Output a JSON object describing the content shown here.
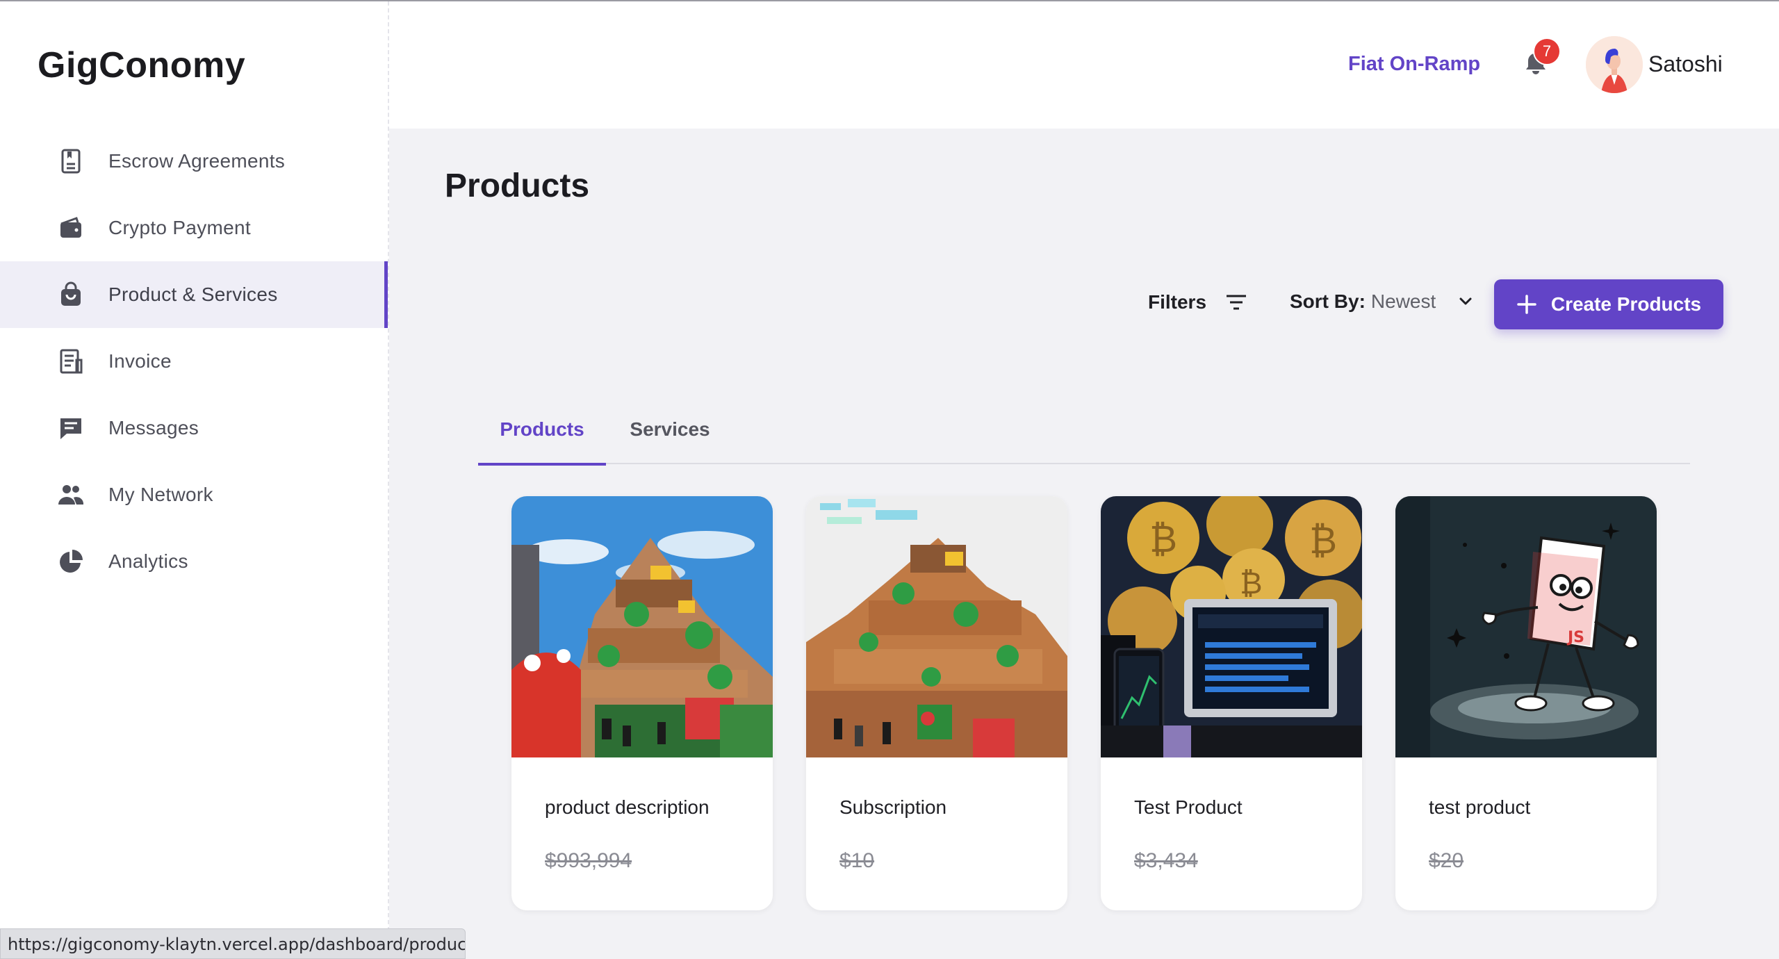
{
  "app": {
    "logo": "GigConomy"
  },
  "sidebar": {
    "items": [
      {
        "label": "Escrow Agreements",
        "icon": "document-icon",
        "active": false
      },
      {
        "label": "Crypto Payment",
        "icon": "wallet-icon",
        "active": false
      },
      {
        "label": "Product & Services",
        "icon": "bag-icon",
        "active": true
      },
      {
        "label": "Invoice",
        "icon": "invoice-icon",
        "active": false
      },
      {
        "label": "Messages",
        "icon": "chat-icon",
        "active": false
      },
      {
        "label": "My Network",
        "icon": "people-icon",
        "active": false
      },
      {
        "label": "Analytics",
        "icon": "pie-chart-icon",
        "active": false
      }
    ]
  },
  "header": {
    "fiat_link": "Fiat On-Ramp",
    "notification_count": "7",
    "username": "Satoshi"
  },
  "main": {
    "title": "Products",
    "filters_label": "Filters",
    "sort_label": "Sort By:",
    "sort_value": "Newest",
    "create_button": "Create Products",
    "tabs": [
      {
        "label": "Products",
        "active": true
      },
      {
        "label": "Services",
        "active": false
      }
    ],
    "products": [
      {
        "title": "product description",
        "price": "$993,994",
        "image": "castle-blue-sky"
      },
      {
        "title": "Subscription",
        "price": "$10",
        "image": "castle-white-sky"
      },
      {
        "title": "Test Product",
        "price": "$3,434",
        "image": "crypto-coins"
      },
      {
        "title": "test product",
        "price": "$20",
        "image": "js-character"
      }
    ]
  },
  "statusbar": {
    "url": "https://gigconomy-klaytn.vercel.app/dashboard/products"
  },
  "colors": {
    "accent": "#6244c7",
    "badge": "#e53935",
    "page_background": "#f2f2f5"
  }
}
